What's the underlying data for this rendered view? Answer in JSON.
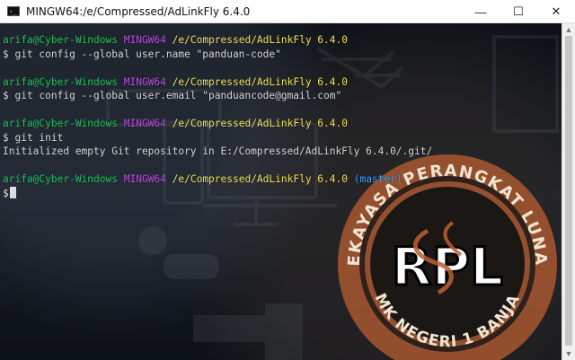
{
  "window": {
    "title": "MINGW64:/e/Compressed/AdLinkFly 6.4.0",
    "icon": "terminal-icon",
    "controls": [
      "minimize-icon",
      "maximize-icon",
      "close-icon"
    ]
  },
  "terminal": {
    "lines": [
      {
        "type": "prompt",
        "user": "arifa@Cyber-Windows",
        "host": "MINGW64",
        "path": "/e/Compressed/AdLinkFly 6.4.0"
      },
      {
        "type": "text",
        "text": "$ git config --global user.name \"panduan-code\""
      },
      {
        "type": "blank"
      },
      {
        "type": "prompt",
        "user": "arifa@Cyber-Windows",
        "host": "MINGW64",
        "path": "/e/Compressed/AdLinkFly 6.4.0"
      },
      {
        "type": "text",
        "text": "$ git config --global user.email \"panduancode@gmail.com\""
      },
      {
        "type": "blank"
      },
      {
        "type": "prompt",
        "user": "arifa@Cyber-Windows",
        "host": "MINGW64",
        "path": "/e/Compressed/AdLinkFly 6.4.0"
      },
      {
        "type": "text",
        "text": "$ git init"
      },
      {
        "type": "text",
        "text": "Initialized empty Git repository in E:/Compressed/AdLinkFly 6.4.0/.git/"
      },
      {
        "type": "blank"
      },
      {
        "type": "prompt",
        "user": "arifa@Cyber-Windows",
        "host": "MINGW64",
        "path": "/e/Compressed/AdLinkFly 6.4.0",
        "branch": "(master)"
      },
      {
        "type": "cursor",
        "text": "$"
      }
    ]
  },
  "background_logo": {
    "top_text": "REKAYASA PERANGKAT LUNAK",
    "center_text": "RPL",
    "bottom_text": "SMK NEGERI 1 BANJAR",
    "colors": {
      "ring": "#b95f31",
      "dark": "#151515",
      "text": "#f0e5d3"
    }
  },
  "colors": {
    "user": "#22c55e",
    "host": "#b94fe0",
    "path": "#f2e25b",
    "branch": "#39a5ff",
    "text": "#d8d8d8"
  }
}
